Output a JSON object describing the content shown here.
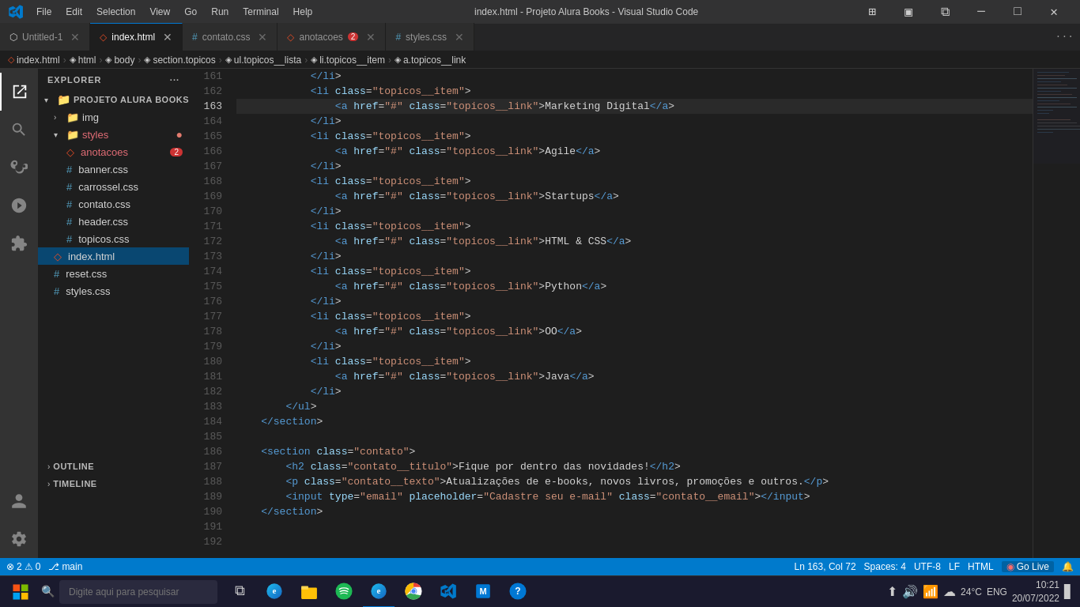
{
  "titlebar": {
    "logo": "vscode-logo",
    "menu": [
      "File",
      "Edit",
      "Selection",
      "View",
      "Go",
      "Run",
      "Terminal",
      "Help"
    ],
    "title": "index.html - Projeto Alura Books - Visual Studio Code",
    "controls": [
      "minimize",
      "maximize",
      "close"
    ]
  },
  "tabs": [
    {
      "label": "Untitled-1",
      "type": "untitled",
      "active": false,
      "modified": false
    },
    {
      "label": "index.html",
      "type": "html",
      "active": true,
      "modified": false
    },
    {
      "label": "contato.css",
      "type": "css",
      "active": false,
      "modified": false
    },
    {
      "label": "anotacoes",
      "type": "html",
      "active": false,
      "modified": false,
      "badge": "2"
    },
    {
      "label": "styles.css",
      "type": "css",
      "active": false,
      "modified": false
    }
  ],
  "breadcrumb": [
    {
      "label": "index.html",
      "icon": "◇"
    },
    {
      "label": "html",
      "icon": "◈"
    },
    {
      "label": "body",
      "icon": "◈"
    },
    {
      "label": "section.topicos",
      "icon": "◈"
    },
    {
      "label": "ul.topicos__lista",
      "icon": "◈"
    },
    {
      "label": "li.topicos__item",
      "icon": "◈"
    },
    {
      "label": "a.topicos__link",
      "icon": "◈"
    }
  ],
  "sidebar": {
    "header": "EXPLORER",
    "project": "PROJETO ALURA BOOKS",
    "items": [
      {
        "label": "img",
        "type": "folder",
        "level": 1,
        "collapsed": true
      },
      {
        "label": "styles",
        "type": "folder",
        "level": 1,
        "collapsed": false,
        "modified": true
      },
      {
        "label": "anotacoes",
        "type": "html",
        "level": 2,
        "badge": "2"
      },
      {
        "label": "banner.css",
        "type": "css",
        "level": 2
      },
      {
        "label": "carrossel.css",
        "type": "css",
        "level": 2
      },
      {
        "label": "contato.css",
        "type": "css",
        "level": 2
      },
      {
        "label": "header.css",
        "type": "css",
        "level": 2
      },
      {
        "label": "topicos.css",
        "type": "css",
        "level": 2
      },
      {
        "label": "index.html",
        "type": "html",
        "level": 1,
        "active": true
      },
      {
        "label": "reset.css",
        "type": "css",
        "level": 1
      },
      {
        "label": "styles.css",
        "type": "css",
        "level": 1
      }
    ],
    "outline": "OUTLINE",
    "timeline": "TIMELINE"
  },
  "statusbar": {
    "errors": "2",
    "warnings": "0",
    "branch": "main",
    "line": "Ln 163, Col 72",
    "spaces": "Spaces: 4",
    "encoding": "UTF-8",
    "lineending": "LF",
    "language": "HTML",
    "golive": "Go Live"
  },
  "code": {
    "startLine": 161,
    "lines": [
      "            </li>",
      "            <li class=\"topicos__item\">",
      "                <a href=\"#\" class=\"topicos__link\">Marketing Digital</a>",
      "            </li>",
      "            <li class=\"topicos__item\">",
      "                <a href=\"#\" class=\"topicos__link\">Agile</a>",
      "            </li>",
      "            <li class=\"topicos__item\">",
      "                <a href=\"#\" class=\"topicos__link\">Startups</a>",
      "            </li>",
      "            <li class=\"topicos__item\">",
      "                <a href=\"#\" class=\"topicos__link\">HTML & CSS</a>",
      "            </li>",
      "            <li class=\"topicos__item\">",
      "                <a href=\"#\" class=\"topicos__link\">Python</a>",
      "            </li>",
      "            <li class=\"topicos__item\">",
      "                <a href=\"#\" class=\"topicos__link\">OO</a>",
      "            </li>",
      "            <li class=\"topicos__item\">",
      "                <a href=\"#\" class=\"topicos__link\">Java</a>",
      "            </li>",
      "        </ul>",
      "    </section>",
      "",
      "    <section class=\"contato\">",
      "        <h2 class=\"contato__titulo\">Fique por dentro das novidades!</h2>",
      "        <p class=\"contato__texto\">Atualizações de e-books, novos livros, promoções e outros.</p>",
      "        <input type=\"email\" placeholder=\"Cadastre seu e-mail\" class=\"contato__email\"></input>",
      "    </section>",
      "",
      ""
    ]
  },
  "taskbar": {
    "search_placeholder": "Digite aqui para pesquisar",
    "time": "10:21",
    "date": "20/07/2022",
    "temperature": "24°C",
    "language": "ENG"
  }
}
